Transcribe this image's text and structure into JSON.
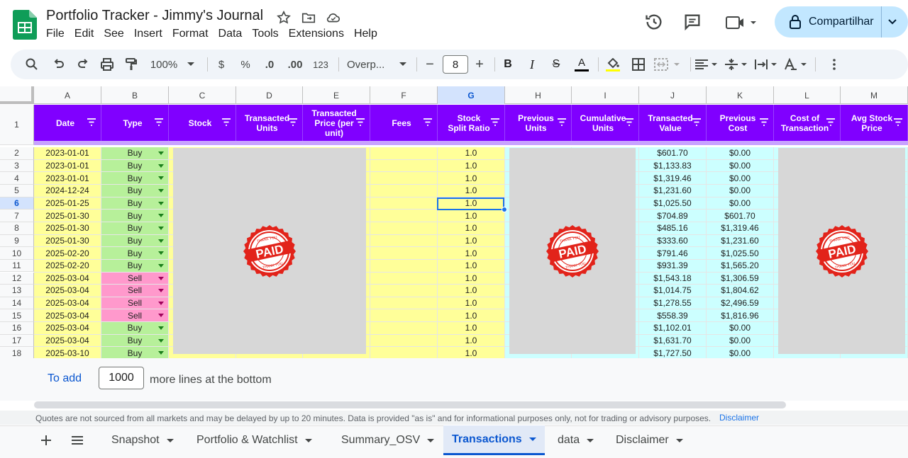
{
  "app": {
    "title": "Portfolio Tracker - Jimmy's Journal",
    "menu": [
      "File",
      "Edit",
      "See",
      "Insert",
      "Format",
      "Data",
      "Tools",
      "Extensions",
      "Help"
    ],
    "share_label": "Compartilhar"
  },
  "toolbar": {
    "zoom": "100%",
    "currency": "$",
    "percent": "%",
    "dec_decrease": ".0",
    "dec_increase": ".00",
    "number_format": "123",
    "font": "Overp...",
    "font_size": "8",
    "minus": "−",
    "plus": "+"
  },
  "sheet": {
    "columns": [
      "A",
      "B",
      "C",
      "D",
      "E",
      "F",
      "G",
      "H",
      "I",
      "J",
      "K",
      "L",
      "M"
    ],
    "selected_column": "G",
    "selected_row": "6",
    "headers": [
      "Date",
      "Type",
      "Stock",
      "Transacted Units",
      "Transacted Price (per unit)",
      "Fees",
      "Stock Split Ratio",
      "Previous Units",
      "Cumulative Units",
      "Transacted Value",
      "Previous Cost",
      "Cost of Transaction",
      "Avg Stock Price"
    ],
    "rows": [
      {
        "n": "2",
        "date": "2023-01-01",
        "type": "Buy",
        "split": "1.0",
        "value": "$601.70",
        "prev_cost": "$0.00"
      },
      {
        "n": "3",
        "date": "2023-01-01",
        "type": "Buy",
        "split": "1.0",
        "value": "$1,133.83",
        "prev_cost": "$0.00"
      },
      {
        "n": "4",
        "date": "2023-01-01",
        "type": "Buy",
        "split": "1.0",
        "value": "$1,319.46",
        "prev_cost": "$0.00"
      },
      {
        "n": "5",
        "date": "2024-12-24",
        "type": "Buy",
        "split": "1.0",
        "value": "$1,231.60",
        "prev_cost": "$0.00"
      },
      {
        "n": "6",
        "date": "2025-01-25",
        "type": "Buy",
        "split": "1.0",
        "value": "$1,025.50",
        "prev_cost": "$0.00"
      },
      {
        "n": "7",
        "date": "2025-01-30",
        "type": "Buy",
        "split": "1.0",
        "value": "$704.89",
        "prev_cost": "$601.70"
      },
      {
        "n": "8",
        "date": "2025-01-30",
        "type": "Buy",
        "split": "1.0",
        "value": "$485.16",
        "prev_cost": "$1,319.46"
      },
      {
        "n": "9",
        "date": "2025-01-30",
        "type": "Buy",
        "split": "1.0",
        "value": "$333.60",
        "prev_cost": "$1,231.60"
      },
      {
        "n": "10",
        "date": "2025-02-20",
        "type": "Buy",
        "split": "1.0",
        "value": "$791.46",
        "prev_cost": "$1,025.50"
      },
      {
        "n": "11",
        "date": "2025-02-20",
        "type": "Buy",
        "split": "1.0",
        "value": "$931.39",
        "prev_cost": "$1,565.20"
      },
      {
        "n": "12",
        "date": "2025-03-04",
        "type": "Sell",
        "split": "1.0",
        "value": "$1,543.18",
        "prev_cost": "$1,306.59"
      },
      {
        "n": "13",
        "date": "2025-03-04",
        "type": "Sell",
        "split": "1.0",
        "value": "$1,014.75",
        "prev_cost": "$1,804.62"
      },
      {
        "n": "14",
        "date": "2025-03-04",
        "type": "Sell",
        "split": "1.0",
        "value": "$1,278.55",
        "prev_cost": "$2,496.59"
      },
      {
        "n": "15",
        "date": "2025-03-04",
        "type": "Sell",
        "split": "1.0",
        "value": "$558.39",
        "prev_cost": "$1,816.96"
      },
      {
        "n": "16",
        "date": "2025-03-04",
        "type": "Buy",
        "split": "1.0",
        "value": "$1,102.01",
        "prev_cost": "$0.00"
      },
      {
        "n": "17",
        "date": "2025-03-04",
        "type": "Buy",
        "split": "1.0",
        "value": "$1,631.70",
        "prev_cost": "$0.00"
      },
      {
        "n": "18",
        "date": "2025-03-10",
        "type": "Buy",
        "split": "1.0",
        "value": "$1,727.50",
        "prev_cost": "$0.00"
      }
    ],
    "header_row_number": "1",
    "stamp_text": "PAID",
    "stamp_small": "THANK YOU"
  },
  "footer": {
    "add_link": "To add",
    "add_count": "1000",
    "add_suffix": "more lines at the bottom",
    "disclaimer_text": "Quotes are not sourced from all markets and may be delayed by up to 20 minutes. Data is provided \"as is\" and for informational purposes only, not for trading or advisory purposes.",
    "disclaimer_link": "Disclaimer"
  },
  "tabs": [
    "Snapshot",
    "Portfolio & Watchlist",
    "Summary_OSV",
    "Transactions",
    "data",
    "Disclaimer"
  ],
  "active_tab": "Transactions",
  "colors": {
    "header_purple": "#8000ff",
    "yellow": "#ffff99",
    "cyan": "#ccffff",
    "buy_green": "#b7f09a",
    "sell_pink": "#ff99cc",
    "accent": "#0b57d0"
  }
}
